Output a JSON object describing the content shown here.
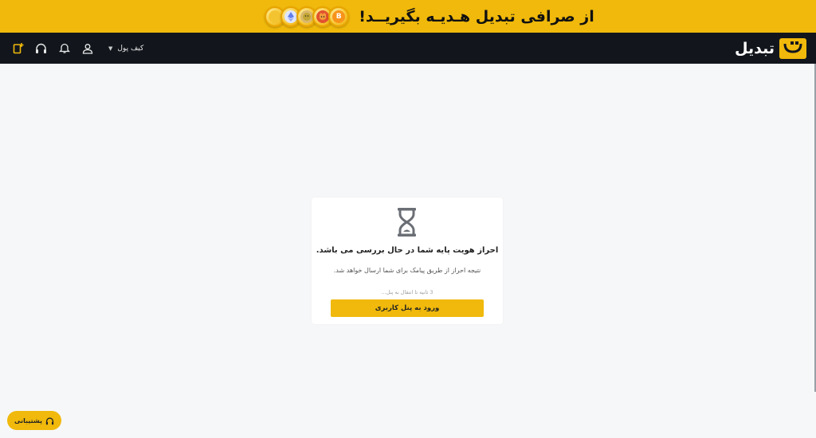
{
  "promo": {
    "text": "از صرافی تبدیل هـدیـه بگیریــد!",
    "coins": [
      {
        "icon": "bitcoin-coin-icon",
        "glyph": "B",
        "color": "#f7931a"
      },
      {
        "icon": "shiba-coin-icon",
        "glyph": "",
        "color": "#e2522f"
      },
      {
        "icon": "doge-coin-icon",
        "glyph": "",
        "color": "#c2a633"
      },
      {
        "icon": "ethereum-coin-icon",
        "glyph": "",
        "color": "#627eea"
      },
      {
        "icon": "gold-coin-icon",
        "glyph": "",
        "color": "#e0a100"
      }
    ]
  },
  "navbar": {
    "brand": "تبدیل",
    "wallet_label": "کیف پول",
    "icons": [
      "deposit-icon",
      "headset-icon",
      "bell-icon",
      "user-icon"
    ]
  },
  "status_card": {
    "icon": "hourglass-icon",
    "title": "احراز هویت پایه شما در حال بررسی می باشد.",
    "description": "نتیجه احراز از طریق پیامک برای شما ارسال خواهد شد.",
    "countdown": "3 ثانیه تا انتقال به پنل...",
    "button_label": "ورود به پنل کاربری"
  },
  "support": {
    "label": "پشتیبانی",
    "icon": "headset-icon"
  },
  "colors": {
    "brand_yellow": "#f0b90b",
    "navbar_bg": "#12161c",
    "page_bg": "#f6f7f8"
  }
}
